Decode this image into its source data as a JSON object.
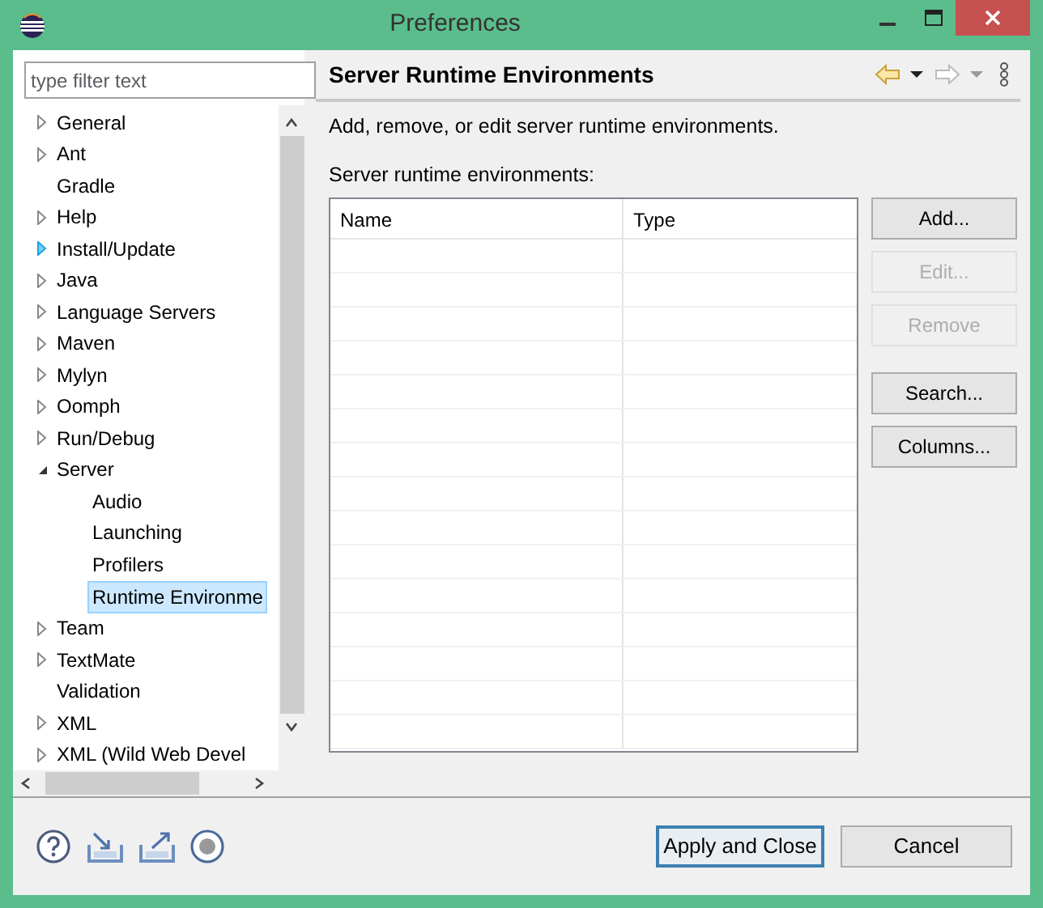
{
  "window": {
    "title": "Preferences"
  },
  "filter": {
    "placeholder": "type filter text"
  },
  "tree": [
    {
      "label": "General",
      "expanded": false,
      "selected": false
    },
    {
      "label": "Ant",
      "expanded": false,
      "selected": false
    },
    {
      "label": "Gradle",
      "selected": false
    },
    {
      "label": "Help",
      "expanded": false,
      "selected": false
    },
    {
      "label": "Install/Update",
      "expanded": false,
      "hovered": true,
      "selected": false
    },
    {
      "label": "Java",
      "expanded": false,
      "selected": false
    },
    {
      "label": "Language Servers",
      "expanded": false,
      "selected": false
    },
    {
      "label": "Maven",
      "expanded": false,
      "selected": false
    },
    {
      "label": "Mylyn",
      "expanded": false,
      "selected": false
    },
    {
      "label": "Oomph",
      "expanded": false,
      "selected": false
    },
    {
      "label": "Run/Debug",
      "expanded": false,
      "selected": false
    },
    {
      "label": "Server",
      "expanded": true,
      "selected": false,
      "children": [
        {
          "label": "Audio",
          "selected": false
        },
        {
          "label": "Launching",
          "selected": false
        },
        {
          "label": "Profilers",
          "selected": false
        },
        {
          "label": "Runtime Environme",
          "selected": true
        }
      ]
    },
    {
      "label": "Team",
      "expanded": false,
      "selected": false
    },
    {
      "label": "TextMate",
      "expanded": false,
      "selected": false
    },
    {
      "label": "Validation",
      "selected": false
    },
    {
      "label": "XML",
      "expanded": false,
      "selected": false
    },
    {
      "label": "XML (Wild Web Devel",
      "expanded": false,
      "selected": false
    }
  ],
  "page": {
    "title": "Server Runtime Environments",
    "description": "Add, remove, or edit server runtime environments.",
    "table_label": "Server runtime environments:",
    "columns": [
      "Name",
      "Type"
    ],
    "buttons": [
      {
        "label": "Add...",
        "disabled": false
      },
      {
        "label": "Edit...",
        "disabled": true
      },
      {
        "label": "Remove",
        "disabled": true
      },
      {
        "label": "Search...",
        "disabled": false,
        "gap": true
      },
      {
        "label": "Columns...",
        "disabled": false
      }
    ]
  },
  "footer_buttons": [
    {
      "label": "Apply and Close",
      "default": true
    },
    {
      "label": "Cancel",
      "default": false
    }
  ]
}
